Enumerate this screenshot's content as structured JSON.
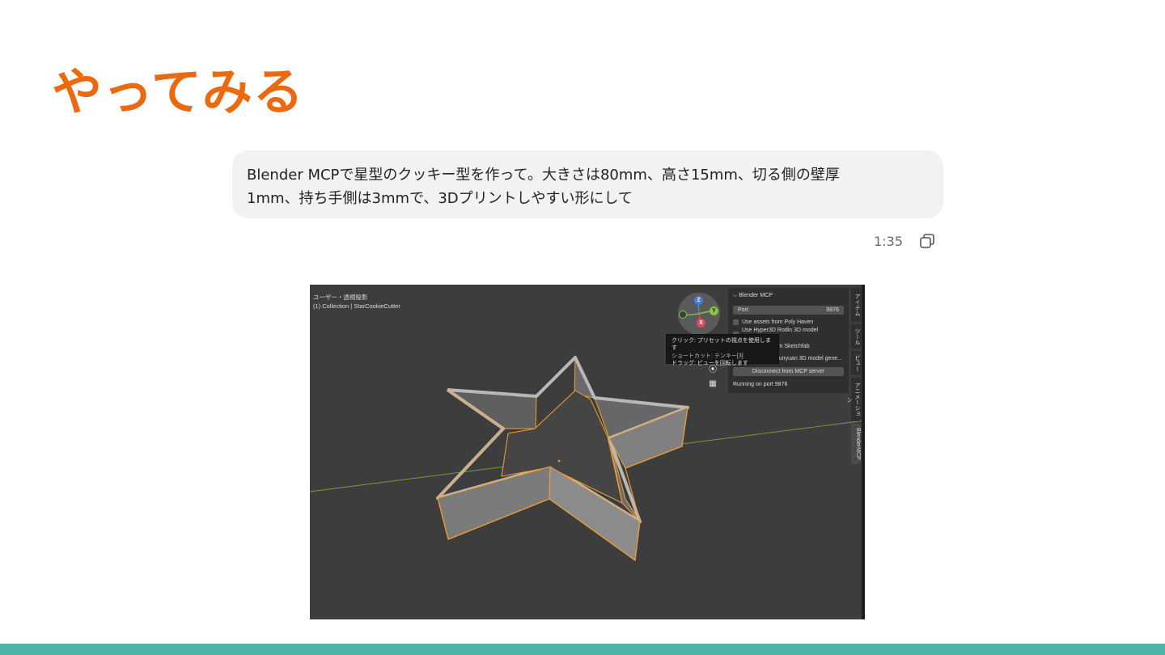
{
  "slide": {
    "title": "やってみる",
    "bottom_bar_color": "#4fb3a8",
    "title_color": "#ea6a12"
  },
  "message": {
    "line1": "Blender MCPで星型のクッキー型を作って。大きさは80mm、高さ15mm、切る側の壁厚",
    "line2": "1mm、持ち手側は3mmで、3Dプリントしやすい形にして",
    "time": "1:35",
    "copy_icon": "copy-icon"
  },
  "blender": {
    "view_label": "ユーザー・透視投影",
    "collection_prefix": "(1) Collection",
    "object_name": "StarCookieCutter",
    "gizmo": {
      "z": "Z",
      "y": "Y",
      "x": "X"
    },
    "tooltip": {
      "line1": "クリック: プリセットの視点を使用します",
      "line2": "ショートカット: テンキー[3]",
      "line3": "ドラッグ: ビューを回転します"
    },
    "panel": {
      "header": "Blender MCP",
      "port_label": "Port",
      "port_value": "9876",
      "opt1": "Use assets from Poly Haven",
      "opt2": "Use Hyper3D Rodin 3D model generati...",
      "opt3": "Use assets from Sketchfab",
      "opt4": "Use Tencent Hunyuan 3D model gene...",
      "disconnect": "Disconnect from MCP server",
      "status": "Running on port 9876"
    },
    "tabs": [
      "アイテム",
      "ツール",
      "ビュー",
      "アニメーション",
      "BlenderMCP"
    ],
    "colors": {
      "outline": "#f7a12c",
      "axis": "#7aa33a",
      "background": "#3d3d3d"
    }
  }
}
